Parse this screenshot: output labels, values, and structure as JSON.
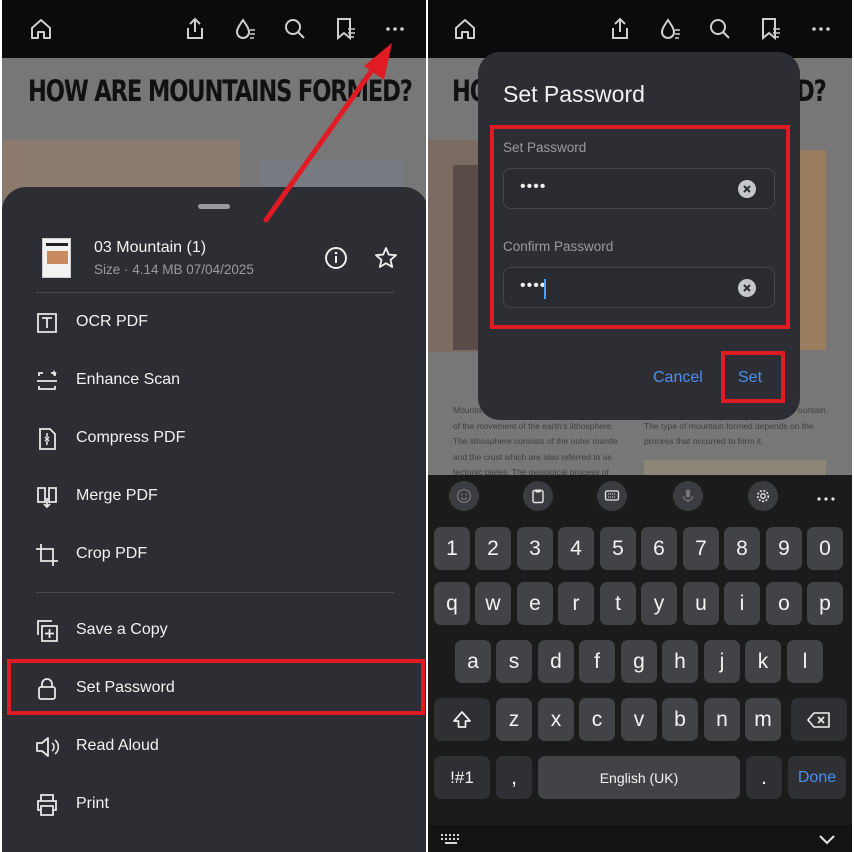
{
  "left_screen": {
    "document": {
      "title": "HOW ARE MOUNTAINS FORMED?"
    },
    "file": {
      "name": "03 Mountain (1)",
      "meta": "Size · 4.14 MB 07/04/2025"
    },
    "menu": [
      {
        "label": "OCR PDF",
        "icon": "ocr-icon"
      },
      {
        "label": "Enhance Scan",
        "icon": "enhance-scan-icon"
      },
      {
        "label": "Compress PDF",
        "icon": "compress-icon"
      },
      {
        "label": "Merge PDF",
        "icon": "merge-icon"
      },
      {
        "label": "Crop PDF",
        "icon": "crop-icon"
      },
      {
        "label": "Save a Copy",
        "icon": "save-copy-icon"
      },
      {
        "label": "Set Password",
        "icon": "lock-icon"
      },
      {
        "label": "Read Aloud",
        "icon": "speaker-icon"
      },
      {
        "label": "Print",
        "icon": "printer-icon"
      }
    ]
  },
  "right_screen": {
    "document": {
      "title_fragment_left": "HO",
      "title_fragment_right": "D?",
      "left_column": [
        "Mounta",
        "of the movement of the earth's lithosphere.",
        "The lithosphere consists of the outer mantle",
        "and the crust which are also referred to as",
        "tectonic plates. The geological process of"
      ],
      "right_column": [
        "ountain.",
        "The type of mountain formed depends on the",
        "process that occurred to form it."
      ]
    },
    "dialog": {
      "title": "Set Password",
      "field1_label": "Set Password",
      "field1_value": "••••",
      "field2_label": "Confirm Password",
      "field2_value": "••••",
      "cancel": "Cancel",
      "set": "Set"
    },
    "keyboard": {
      "numbers": [
        "1",
        "2",
        "3",
        "4",
        "5",
        "6",
        "7",
        "8",
        "9",
        "0"
      ],
      "row1": [
        "q",
        "w",
        "e",
        "r",
        "t",
        "y",
        "u",
        "i",
        "o",
        "p"
      ],
      "row2": [
        "a",
        "s",
        "d",
        "f",
        "g",
        "h",
        "j",
        "k",
        "l"
      ],
      "row3": [
        "z",
        "x",
        "c",
        "v",
        "b",
        "n",
        "m"
      ],
      "symbols": "!#1",
      "comma": ",",
      "space": "English (UK)",
      "period": ".",
      "done": "Done"
    }
  },
  "colors": {
    "highlight": "#e01b24",
    "accent": "#4b8ff0",
    "sheet": "#2d2e33"
  }
}
